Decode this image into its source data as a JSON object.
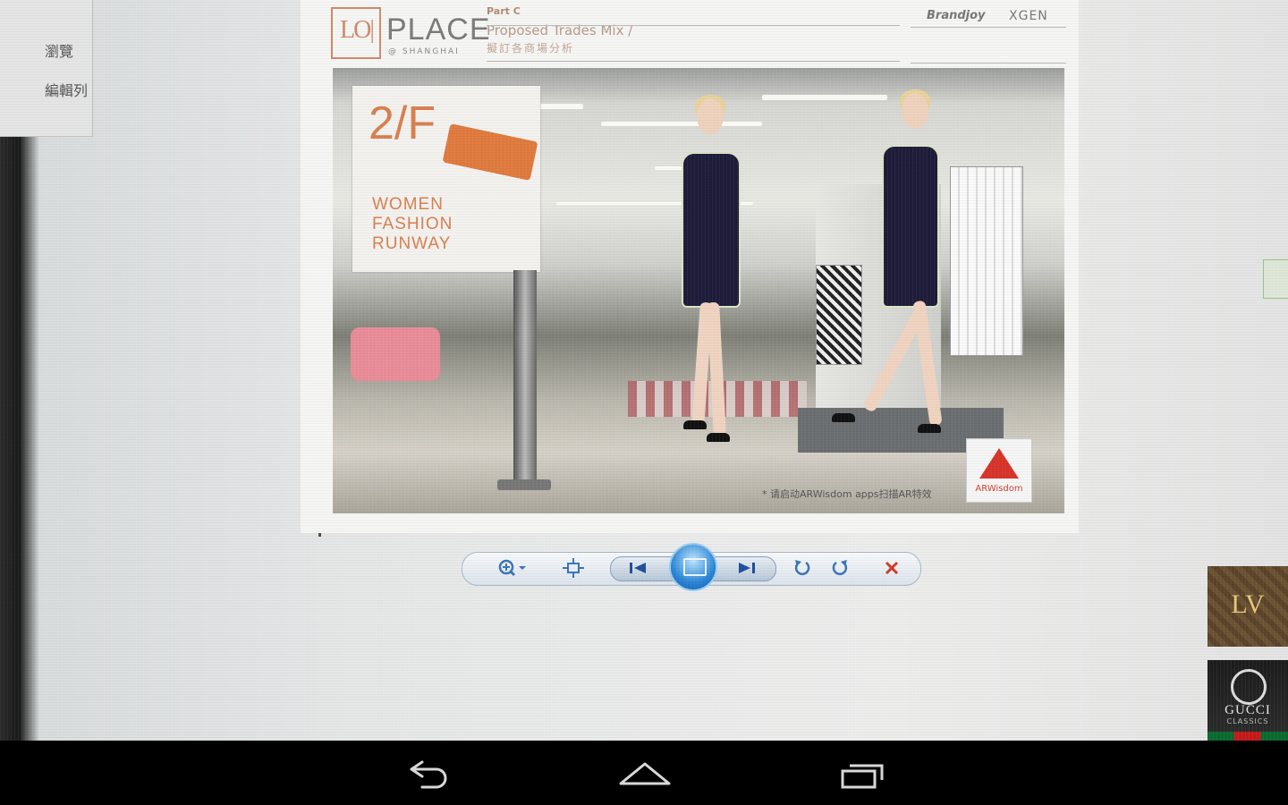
{
  "left_panel": {
    "items": [
      "瀏覽",
      "編輯列"
    ]
  },
  "slide": {
    "logo_mark": "LO|",
    "logo_word": "PLACE",
    "logo_sub": "@ SHANGHAI",
    "part_label": "Part C",
    "section_title": "Proposed Trades Mix /",
    "section_title_cn": "擬訂各商場分析",
    "brands": [
      "Brandjoy",
      "XGEN"
    ],
    "sign": {
      "floor": "2/F",
      "lines": [
        "WOMEN",
        "FASHION",
        "RUNWAY"
      ]
    },
    "badge": "ARWisdom",
    "note": "* 请启动ARWisdom apps扫描AR特效"
  },
  "viewer_toolbar": {
    "buttons": [
      {
        "name": "zoom",
        "icon": "zoom-icon"
      },
      {
        "name": "fit",
        "icon": "fit-window-icon"
      },
      {
        "name": "previous",
        "icon": "skip-previous-icon"
      },
      {
        "name": "slideshow",
        "icon": "slideshow-icon"
      },
      {
        "name": "next",
        "icon": "skip-next-icon"
      },
      {
        "name": "rotate-left",
        "icon": "rotate-ccw-icon"
      },
      {
        "name": "rotate-right",
        "icon": "rotate-cw-icon"
      },
      {
        "name": "delete",
        "icon": "close-icon"
      }
    ],
    "colors": {
      "icon": "#3b74b8",
      "delete": "#d23a2a",
      "play": "#2a86d6"
    }
  },
  "thumbnails": [
    {
      "label": "LV"
    },
    {
      "label": "GUCCI",
      "sub": "CLASSICS"
    }
  ],
  "android_nav": [
    "back-icon",
    "home-icon",
    "recents-icon"
  ]
}
